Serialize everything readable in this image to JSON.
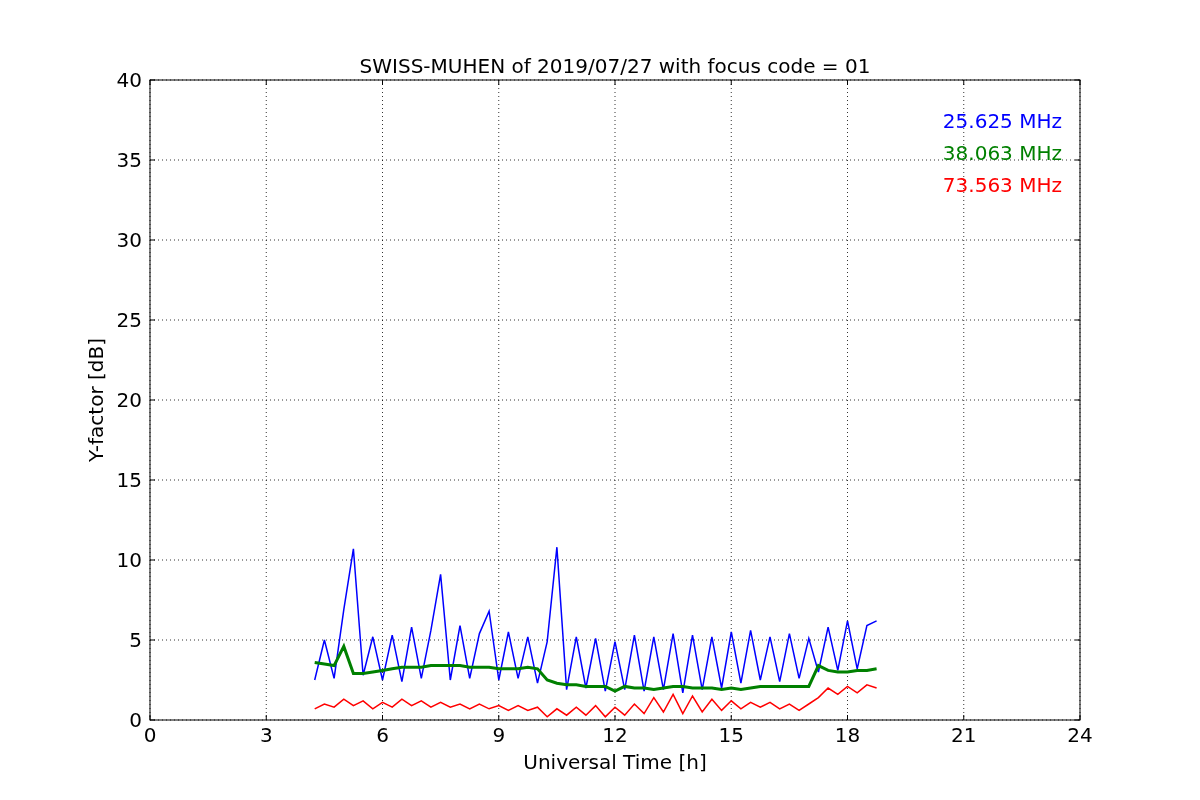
{
  "chart_data": {
    "type": "line",
    "grid": true,
    "title": "SWISS-MUHEN of 2019/07/27 with focus code = 01",
    "xlabel": "Universal Time [h]",
    "ylabel": "Y-factor [dB]",
    "xlim": [
      0,
      24
    ],
    "ylim": [
      0,
      40
    ],
    "xticks": [
      0,
      3,
      6,
      9,
      12,
      15,
      18,
      21,
      24
    ],
    "yticks": [
      0,
      5,
      10,
      15,
      20,
      25,
      30,
      35,
      40
    ],
    "x": [
      4.25,
      4.5,
      4.75,
      5,
      5.25,
      5.5,
      5.75,
      6,
      6.25,
      6.5,
      6.75,
      7,
      7.25,
      7.5,
      7.75,
      8,
      8.25,
      8.5,
      8.75,
      9,
      9.25,
      9.5,
      9.75,
      10,
      10.25,
      10.5,
      10.75,
      11,
      11.25,
      11.5,
      11.75,
      12,
      12.25,
      12.5,
      12.75,
      13,
      13.25,
      13.5,
      13.75,
      14,
      14.25,
      14.5,
      14.75,
      15,
      15.25,
      15.5,
      15.75,
      16,
      16.25,
      16.5,
      16.75,
      17,
      17.25,
      17.5,
      17.75,
      18,
      18.25,
      18.5,
      18.75
    ],
    "series": [
      {
        "name": "25.625 MHz",
        "color": "#0000ff",
        "values": [
          2.5,
          5,
          2.6,
          6.9,
          10.7,
          2.8,
          5.2,
          2.5,
          5.3,
          2.4,
          5.8,
          2.6,
          5.6,
          9.1,
          2.5,
          5.9,
          2.6,
          5.4,
          6.8,
          2.5,
          5.5,
          2.6,
          5.2,
          2.3,
          4.9,
          10.8,
          1.9,
          5.2,
          2.0,
          5.1,
          1.8,
          4.9,
          1.9,
          5.3,
          1.8,
          5.2,
          1.9,
          5.4,
          1.7,
          5.3,
          1.9,
          5.2,
          2.0,
          5.5,
          2.3,
          5.6,
          2.5,
          5.2,
          2.4,
          5.4,
          2.6,
          5.1,
          3.0,
          5.8,
          3.1,
          6.2,
          3.2,
          5.9,
          6.2
        ]
      },
      {
        "name": "38.063 MHz",
        "color": "#008000",
        "values": [
          3.6,
          3.5,
          3.4,
          4.6,
          2.9,
          2.9,
          3.0,
          3.1,
          3.2,
          3.3,
          3.3,
          3.3,
          3.4,
          3.4,
          3.4,
          3.4,
          3.3,
          3.3,
          3.3,
          3.2,
          3.2,
          3.2,
          3.3,
          3.2,
          2.5,
          2.3,
          2.2,
          2.2,
          2.1,
          2.1,
          2.1,
          1.8,
          2.1,
          2.0,
          2.0,
          1.9,
          2.0,
          2.1,
          2.1,
          2.0,
          2.0,
          2.0,
          1.9,
          2.0,
          1.9,
          2.0,
          2.1,
          2.1,
          2.1,
          2.1,
          2.1,
          2.1,
          3.4,
          3.1,
          3.0,
          3.0,
          3.1,
          3.1,
          3.2
        ]
      },
      {
        "name": "73.563 MHz",
        "color": "#ff0000",
        "values": [
          0.7,
          1.0,
          0.8,
          1.3,
          0.9,
          1.2,
          0.7,
          1.1,
          0.8,
          1.3,
          0.9,
          1.2,
          0.8,
          1.1,
          0.8,
          1.0,
          0.7,
          1.0,
          0.7,
          0.9,
          0.6,
          0.9,
          0.6,
          0.8,
          0.2,
          0.7,
          0.3,
          0.8,
          0.3,
          0.9,
          0.2,
          0.8,
          0.3,
          1.0,
          0.4,
          1.4,
          0.5,
          1.6,
          0.4,
          1.5,
          0.5,
          1.3,
          0.6,
          1.2,
          0.7,
          1.1,
          0.8,
          1.1,
          0.7,
          1.0,
          0.6,
          1.0,
          1.4,
          2.0,
          1.6,
          2.1,
          1.7,
          2.2,
          2.0
        ]
      }
    ]
  }
}
